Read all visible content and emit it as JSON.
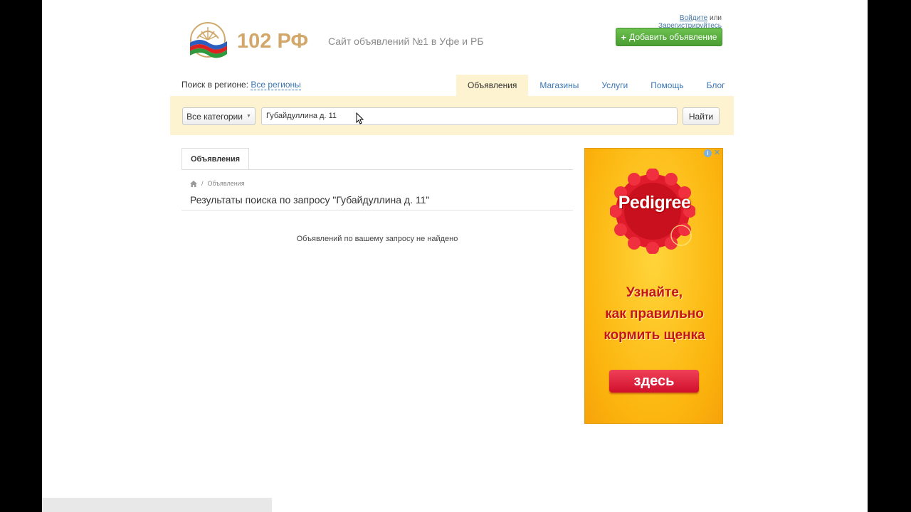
{
  "header": {
    "logo_text": "102 РФ",
    "tagline": "Сайт объявлений №1 в Уфе и РБ",
    "login_link": "Войдите",
    "or_text": "или",
    "register_link": "Зарегистрируйтесь",
    "add_button": "Добавить объявление"
  },
  "region": {
    "label": "Поиск в регионе:",
    "value": "Все регионы"
  },
  "nav_tabs": [
    "Объявления",
    "Магазины",
    "Услуги",
    "Помощь",
    "Блог"
  ],
  "search": {
    "category": "Все категории",
    "query": "Губайдуллина д. 11",
    "find_button": "Найти"
  },
  "content": {
    "tab": "Объявления",
    "breadcrumb": "Объявления",
    "results_title": "Результаты поиска по запросу \"Губайдуллина д. 11\"",
    "empty_message": "Объявлений по вашему запросу не найдено"
  },
  "ad": {
    "brand": "Pedigree",
    "line1": "Узнайте,",
    "line2": "как правильно",
    "line3": "кормить щенка",
    "button": "здесь",
    "colors": {
      "background": "#fcb50e",
      "text": "#c41616",
      "button": "#e0203c"
    }
  }
}
